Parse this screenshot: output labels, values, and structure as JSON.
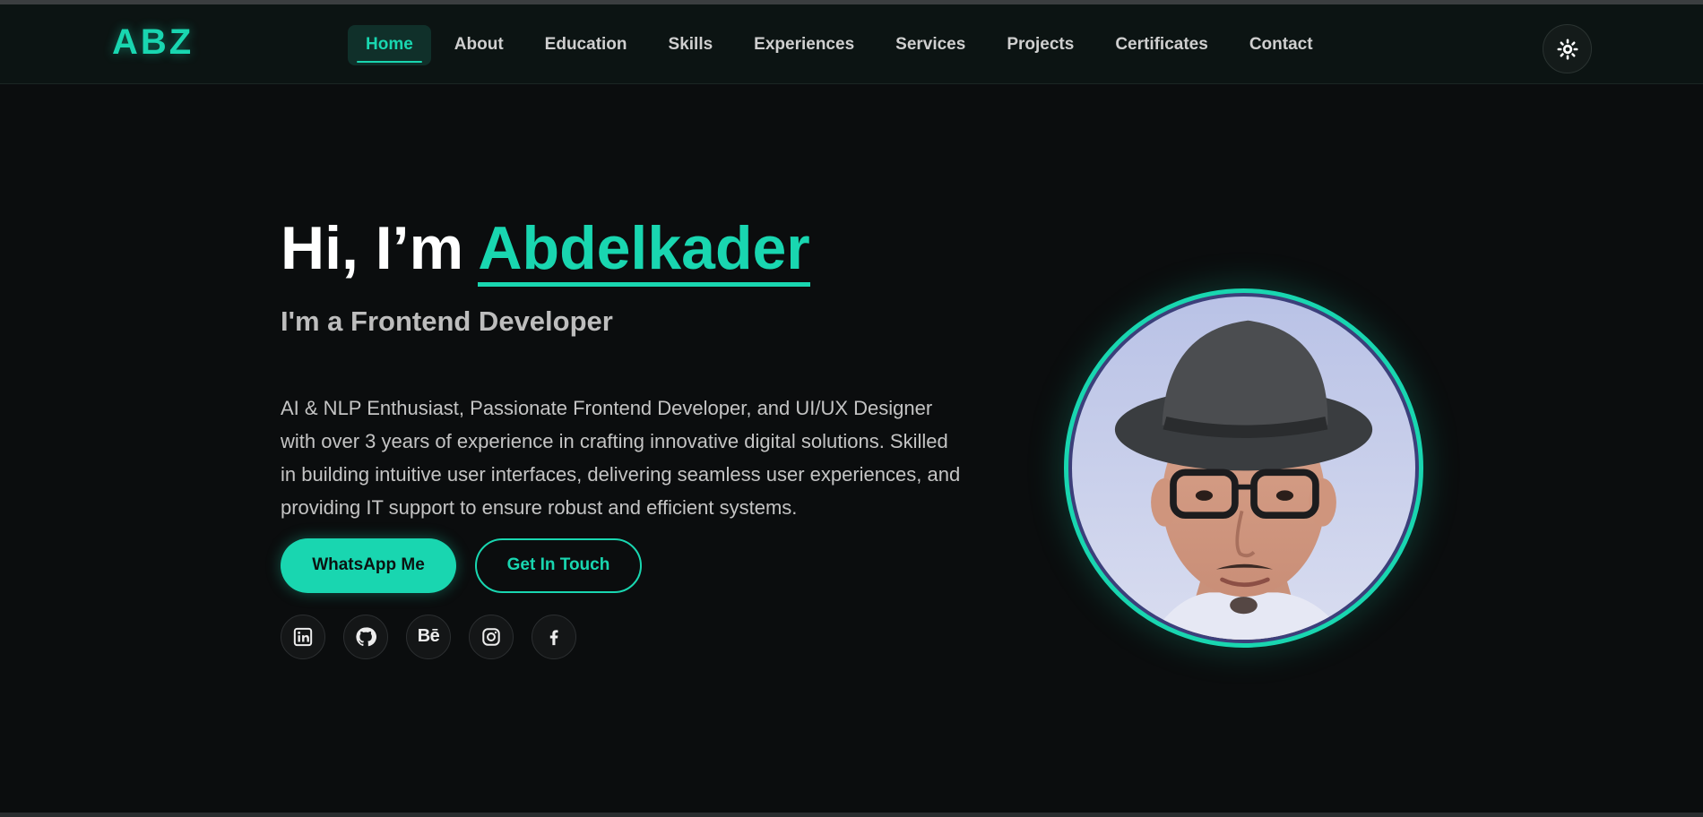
{
  "brand": {
    "logo": "ABZ",
    "accent_color": "#19d6b0"
  },
  "nav": {
    "items": [
      {
        "label": "Home",
        "active": true
      },
      {
        "label": "About"
      },
      {
        "label": "Education"
      },
      {
        "label": "Skills"
      },
      {
        "label": "Experiences"
      },
      {
        "label": "Services"
      },
      {
        "label": "Projects"
      },
      {
        "label": "Certificates"
      },
      {
        "label": "Contact"
      }
    ],
    "theme_toggle_icon": "sun-icon"
  },
  "hero": {
    "greeting": "Hi, I’m",
    "name": "Abdelkader",
    "role": "I'm a Frontend Developer",
    "description": "AI & NLP Enthusiast, Passionate Frontend Developer, and UI/UX Designer with over 3 years of experience in crafting innovative digital solutions. Skilled in building intuitive user interfaces, delivering seamless user experiences, and providing IT support to ensure robust and efficient systems.",
    "primary_button": "WhatsApp Me",
    "secondary_button": "Get In Touch",
    "socials": [
      "linkedin-icon",
      "github-icon",
      "behance-icon",
      "instagram-icon",
      "facebook-icon"
    ],
    "behance_glyph": "Bē"
  }
}
